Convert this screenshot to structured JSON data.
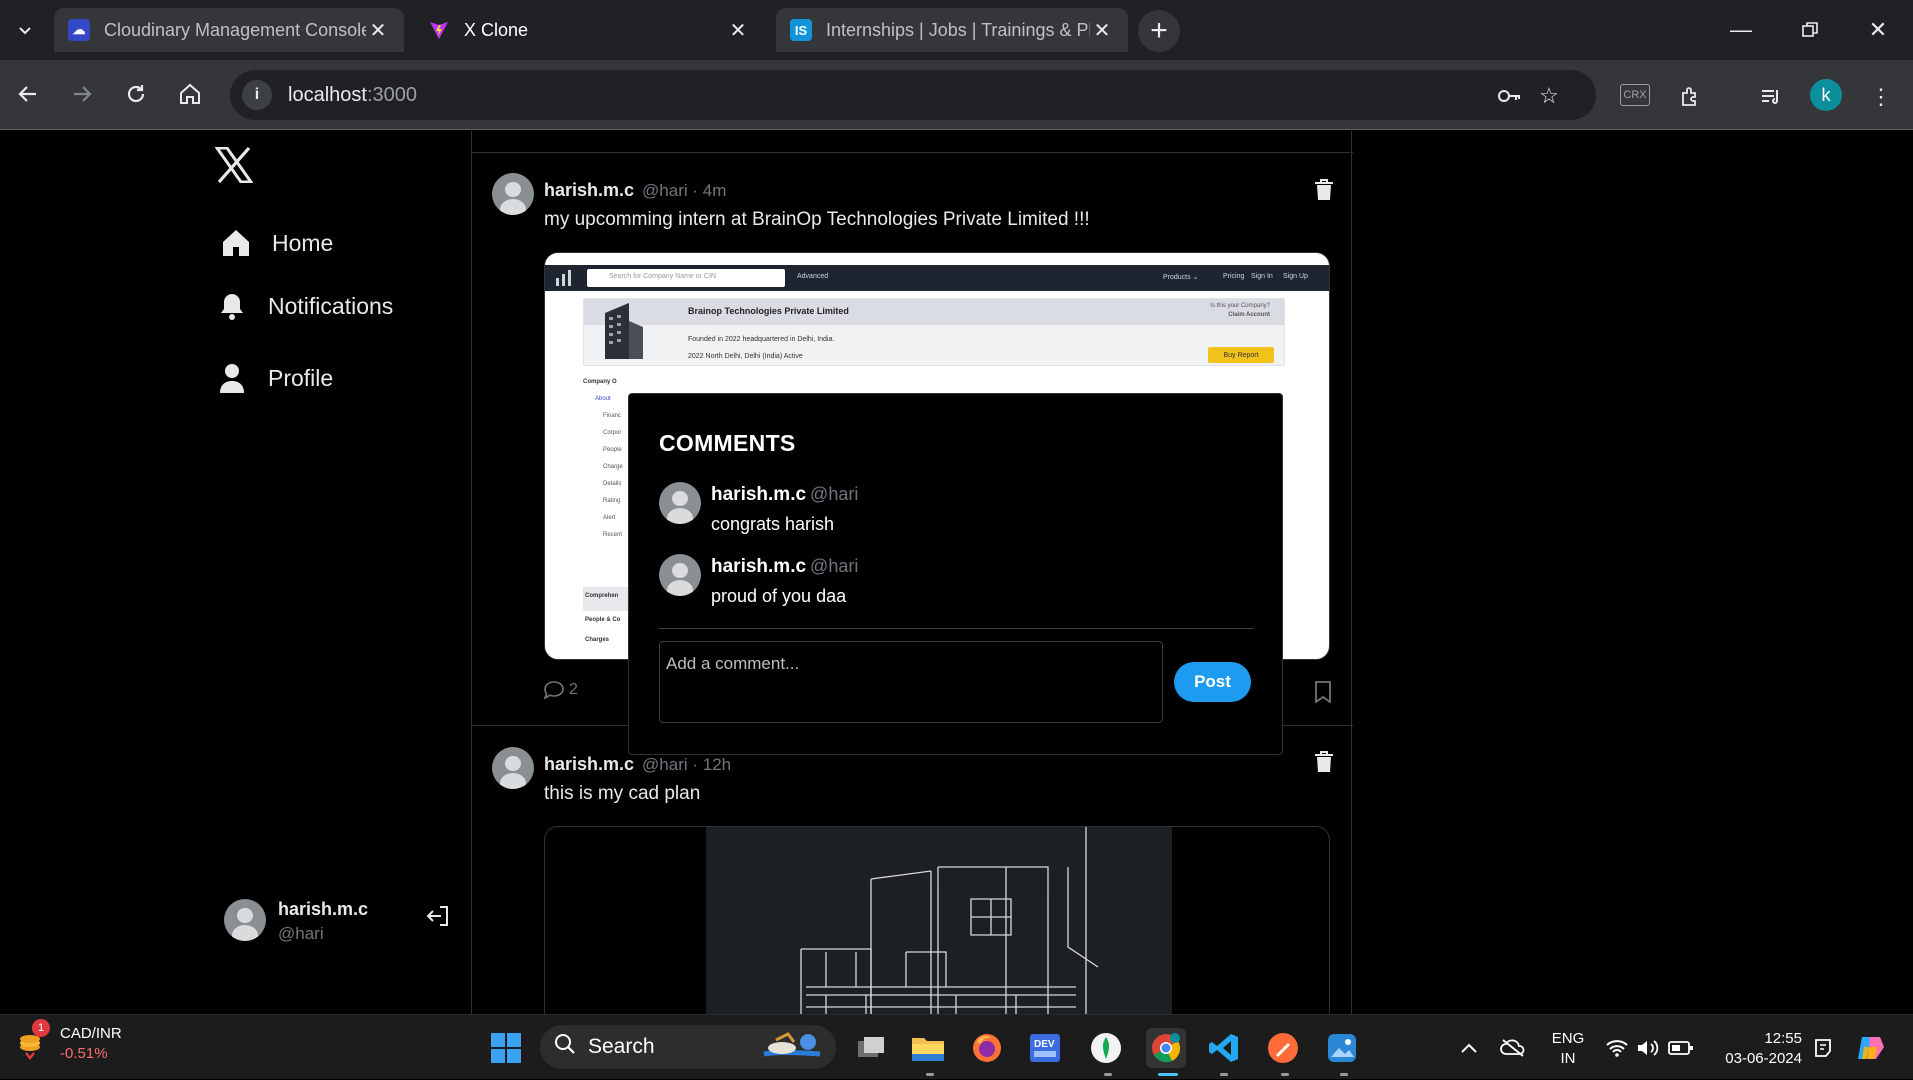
{
  "browser": {
    "tabs": [
      {
        "title": "Cloudinary Management Console",
        "favicon": "cloudinary-icon",
        "color": "#3448c5"
      },
      {
        "title": "X Clone",
        "favicon": "vite-icon",
        "color": "#bd34fe"
      },
      {
        "title": "Internships | Jobs | Trainings & Placements",
        "favicon": "internshala-icon",
        "color": "#1295d8"
      }
    ],
    "url_host": "localhost",
    "url_port": ":3000",
    "profile_initial": "k",
    "ext_label": "CRX"
  },
  "sidebar": {
    "items": [
      {
        "label": "Home",
        "icon": "home-icon"
      },
      {
        "label": "Notifications",
        "icon": "bell-icon"
      },
      {
        "label": "Profile",
        "icon": "person-icon"
      }
    ],
    "user": {
      "name": "harish.m.c",
      "handle": "@hari"
    }
  },
  "posts": [
    {
      "name": "harish.m.c",
      "meta": "@hari · 4m",
      "text": "my upcomming intern at BrainOp Technologies Private Limited !!!",
      "comment_count": "2",
      "media": {
        "search_placeholder": "Search for Company Name or CIN",
        "advanced": "Advanced",
        "nav": [
          "Products ⌄",
          "Pricing",
          "Sign In",
          "Sign Up"
        ],
        "company": "Brainop Technologies Private Limited",
        "claim_line1": "Is this your Company?",
        "claim_line2": "Claim Account",
        "founded": "Founded in 2022 headquartered in Delhi, India.",
        "meta": "2022     North Delhi, Delhi (India)     Active",
        "buy": "Buy Report",
        "side_title": "Company O",
        "side": [
          "About",
          "Financ",
          "Corpor",
          "People",
          "Charge",
          "Details",
          "Rating",
          "Alert",
          "Recent"
        ],
        "bottom": [
          "Comprehen",
          "People & Co",
          "Charges"
        ]
      }
    },
    {
      "name": "harish.m.c",
      "meta": "@hari · 12h",
      "text": "this is my cad plan"
    }
  ],
  "modal": {
    "title": "COMMENTS",
    "comments": [
      {
        "name": "harish.m.c",
        "handle": "@hari",
        "text": "congrats harish"
      },
      {
        "name": "harish.m.c",
        "handle": "@hari",
        "text": "proud of you daa"
      }
    ],
    "placeholder": "Add a comment...",
    "post_label": "Post"
  },
  "taskbar": {
    "weather_badge": "1",
    "ticker": "CAD/INR",
    "change": "-0.51%",
    "search_label": "Search",
    "lang1": "ENG",
    "lang2": "IN",
    "time": "12:55",
    "date": "03-06-2024"
  },
  "colors": {
    "accent": "#1d9bf0",
    "bg": "#000000",
    "muted": "#71767b"
  }
}
